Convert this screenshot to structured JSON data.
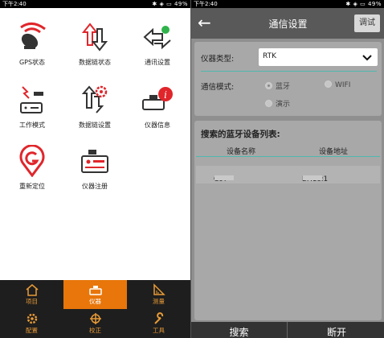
{
  "left": {
    "status": {
      "time": "下午2:40",
      "battery": "49%"
    },
    "grid": [
      {
        "label": "GPS状态",
        "icon": "satellite-dish-icon"
      },
      {
        "label": "数据链状态",
        "icon": "updown-arrows-icon"
      },
      {
        "label": "通讯设置",
        "icon": "comm-arrows-icon"
      },
      {
        "label": "工作模式",
        "icon": "work-mode-icon"
      },
      {
        "label": "数据链设置",
        "icon": "datalink-gear-icon"
      },
      {
        "label": "仪器信息",
        "icon": "device-info-icon"
      },
      {
        "label": "重新定位",
        "icon": "relocate-icon"
      },
      {
        "label": "仪器注册",
        "icon": "device-register-icon"
      }
    ],
    "nav": [
      {
        "label": "项目",
        "icon": "home-icon"
      },
      {
        "label": "仪器",
        "icon": "device-icon",
        "active": true
      },
      {
        "label": "测量",
        "icon": "ruler-icon"
      },
      {
        "label": "配置",
        "icon": "gear-icon"
      },
      {
        "label": "校正",
        "icon": "crosshair-icon"
      },
      {
        "label": "工具",
        "icon": "wrench-icon"
      }
    ]
  },
  "right": {
    "status": {
      "time": "下午2:40",
      "battery": "49%"
    },
    "title": "通信设置",
    "debug_label": "调试",
    "instrument_type": {
      "label": "仪器类型:",
      "value": "RTK"
    },
    "comm_mode": {
      "label": "通信模式:",
      "options": [
        "蓝牙",
        "WIFI",
        "演示"
      ],
      "selected": "蓝牙"
    },
    "bt_list": {
      "title": "搜索的蓝牙设备列表:",
      "col_name": "设备名称",
      "col_addr": "设备地址",
      "rows": [
        {
          "name": "G97",
          "addr": "BF:18:1"
        }
      ]
    },
    "actions": {
      "search": "搜索",
      "disconnect": "断开"
    }
  },
  "colors": {
    "accent": "#e8760a",
    "nav_bg": "#1e1e1e",
    "red": "#e0262b",
    "teal": "#4fb8b0"
  }
}
